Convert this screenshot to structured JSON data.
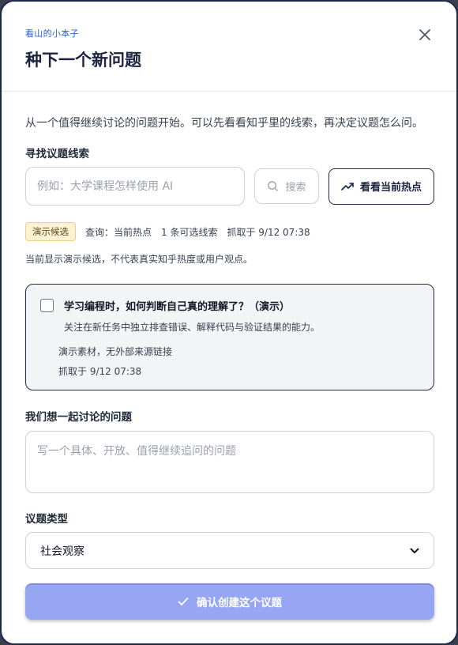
{
  "header": {
    "kicker": "看山的小本子",
    "title": "种下一个新问题",
    "close_icon": "close-icon"
  },
  "intro": "从一个值得继续讨论的问题开始。可以先看看知乎里的线索，再决定议题怎么问。",
  "clue_section": {
    "label": "寻找议题线索",
    "search_placeholder": "例如：大学课程怎样使用 AI",
    "search_value": "",
    "search_button": "搜索",
    "search_icon": "search-icon",
    "hot_button": "看看当前热点",
    "hot_icon": "trending-up-icon"
  },
  "status": {
    "badge": "演示候选",
    "query": "查询：当前热点",
    "count": "1 条可选线索",
    "fetched": "抓取于 9/12 07:38",
    "note": "当前显示演示候选，不代表真实知乎热度或用户观点。"
  },
  "candidate": {
    "checked": false,
    "title": "学习编程时，如何判断自己真的理解了？（演示）",
    "description": "关注在新任务中独立排查错误、解释代码与验证结果的能力。",
    "source": "演示素材，无外部来源链接",
    "fetched": "抓取于 9/12 07:38"
  },
  "question_section": {
    "label": "我们想一起讨论的问题",
    "placeholder": "写一个具体、开放、值得继续追问的问题",
    "value": ""
  },
  "type_section": {
    "label": "议题类型",
    "selected": "社会观察"
  },
  "confirm_button": {
    "label": "确认创建这个议题",
    "icon": "check-icon"
  },
  "colors": {
    "navy": "#1e2a4a",
    "accent": "#2f5ad4",
    "confirm_bg": "#97a6f2",
    "badge_bg": "#fdf3d4",
    "card_bg": "#f3f4f6"
  }
}
